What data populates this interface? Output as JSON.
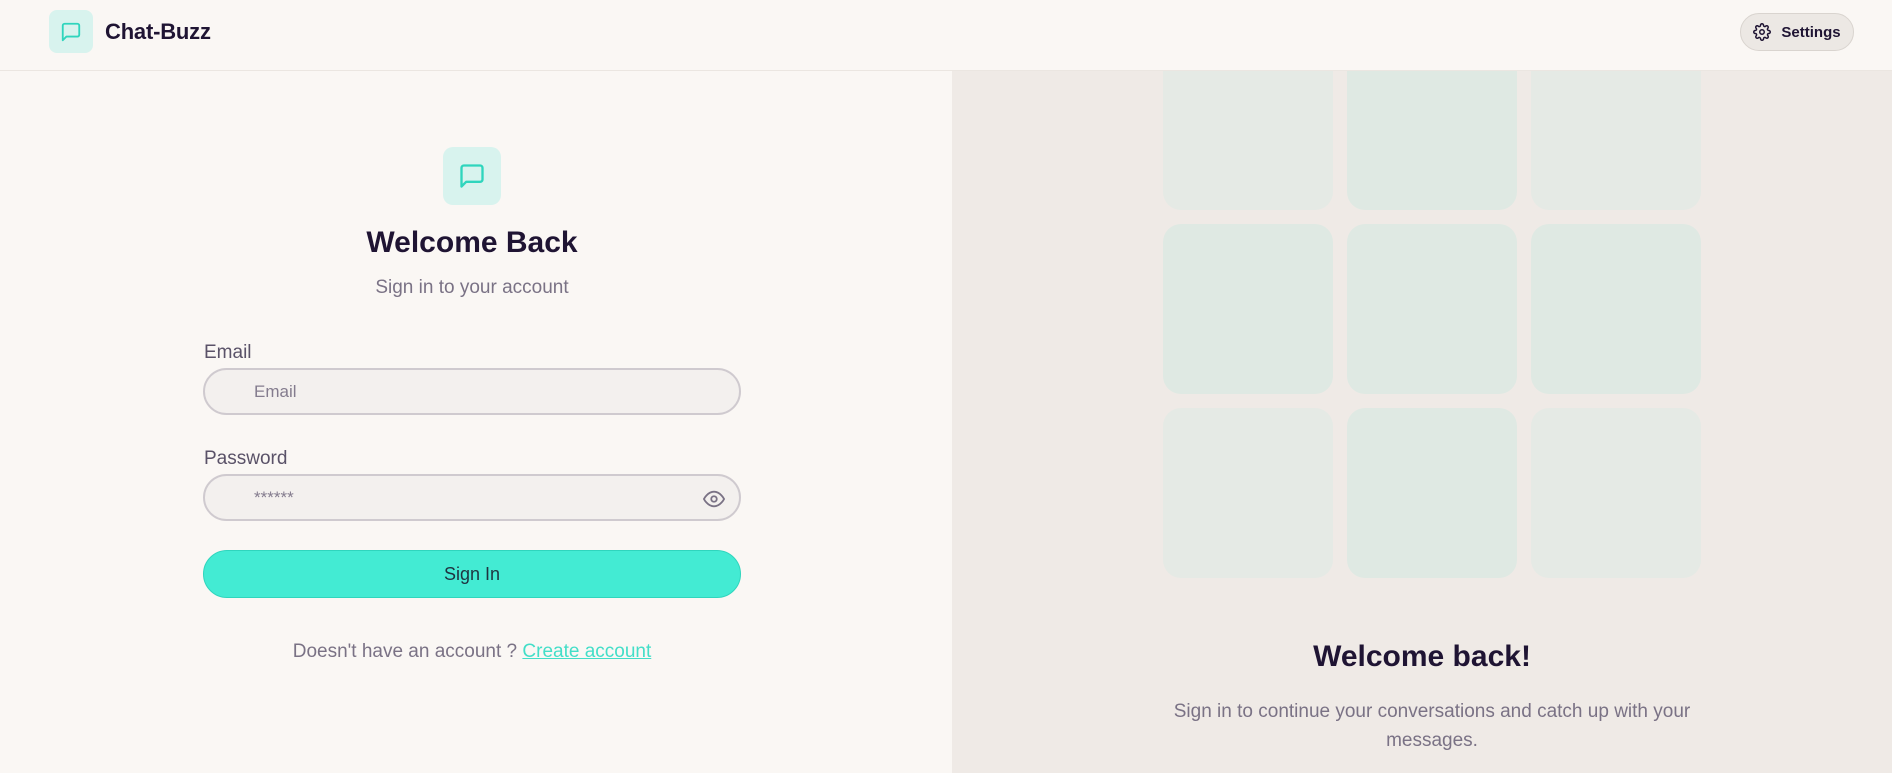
{
  "header": {
    "app_title": "Chat-Buzz",
    "logo_icon": "message-square-icon",
    "settings_label": "Settings",
    "settings_icon": "gear-icon"
  },
  "login": {
    "icon": "message-square-icon",
    "title": "Welcome Back",
    "subtitle": "Sign in to your account",
    "email_label": "Email",
    "email_placeholder": "Email",
    "email_value": "",
    "password_label": "Password",
    "password_placeholder": "******",
    "password_value": "",
    "password_toggle_icon": "eye-icon",
    "submit_label": "Sign In",
    "footer_text": "Doesn't have an account ?",
    "footer_link": "Create account"
  },
  "side_panel": {
    "title": "Welcome back!",
    "subtitle": "Sign in to continue your conversations and catch up with your messages."
  },
  "colors": {
    "accent": "#43ebd3",
    "accent_soft": "#d8f3ee",
    "text_dark": "#1f1433",
    "text_muted": "#7a7285",
    "panel_bg": "#efeae6",
    "page_bg": "#faf7f4"
  }
}
